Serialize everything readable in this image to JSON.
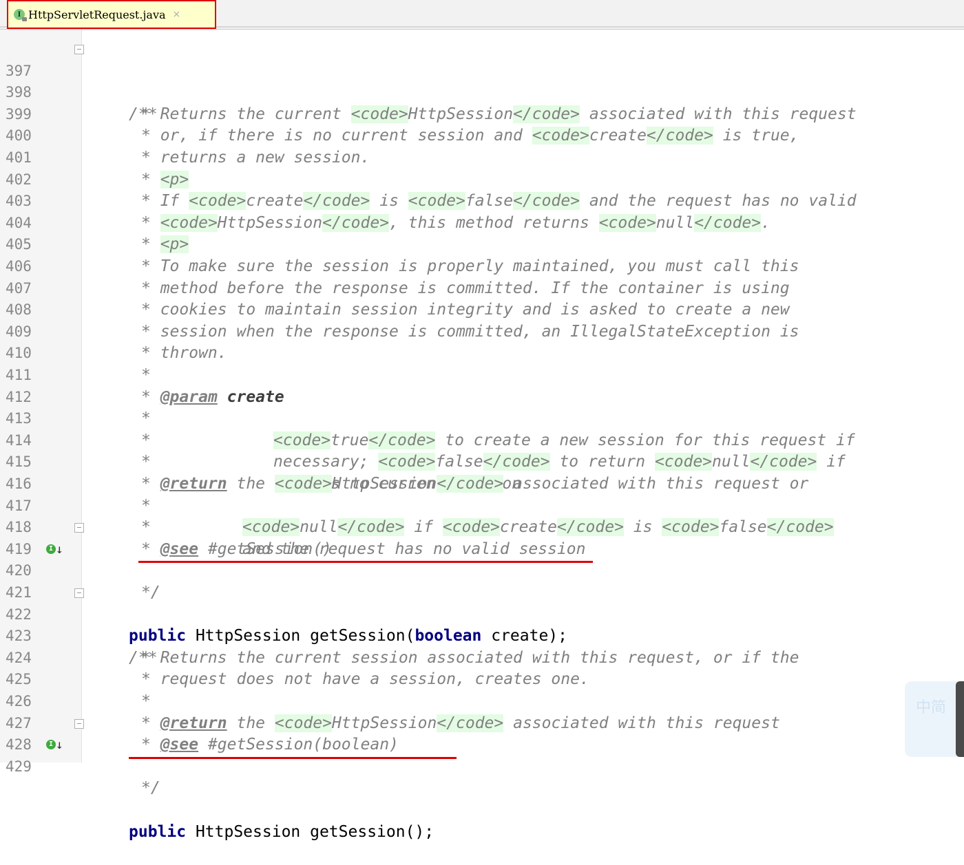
{
  "tab": {
    "icon_letter": "I",
    "filename": "HttpServletRequest.java",
    "close_glyph": "×"
  },
  "lines": [
    {
      "n": "397"
    },
    {
      "n": "398"
    },
    {
      "n": "399"
    },
    {
      "n": "400"
    },
    {
      "n": "401"
    },
    {
      "n": "402"
    },
    {
      "n": "403"
    },
    {
      "n": "404"
    },
    {
      "n": "405"
    },
    {
      "n": "406"
    },
    {
      "n": "407"
    },
    {
      "n": "408"
    },
    {
      "n": "409"
    },
    {
      "n": "410"
    },
    {
      "n": "411"
    },
    {
      "n": "412"
    },
    {
      "n": "413"
    },
    {
      "n": "414"
    },
    {
      "n": "415"
    },
    {
      "n": "416"
    },
    {
      "n": "417"
    },
    {
      "n": "418"
    },
    {
      "n": "419"
    },
    {
      "n": "420"
    },
    {
      "n": "421"
    },
    {
      "n": "422"
    },
    {
      "n": "423"
    },
    {
      "n": "424"
    },
    {
      "n": "425"
    },
    {
      "n": "426"
    },
    {
      "n": "427"
    },
    {
      "n": "428"
    },
    {
      "n": "429"
    }
  ],
  "code": {
    "l397": "/**",
    "l398a": "* Returns the current ",
    "l398t1": "<code>",
    "l398b": "HttpSession",
    "l398t2": "</code>",
    "l398c": " associated with this request",
    "l399a": "* or, if there is no current session and ",
    "l399t1": "<code>",
    "l399b": "create",
    "l399t2": "</code>",
    "l399c": " is true,",
    "l400": "* returns a new session.",
    "l401a": "* ",
    "l401t": "<p>",
    "l402a": "* If ",
    "l402t1": "<code>",
    "l402b": "create",
    "l402t2": "</code>",
    "l402c": " is ",
    "l402t3": "<code>",
    "l402d": "false",
    "l402t4": "</code>",
    "l402e": " and the request has no valid",
    "l403a": "* ",
    "l403t1": "<code>",
    "l403b": "HttpSession",
    "l403t2": "</code>",
    "l403c": ", this method returns ",
    "l403t3": "<code>",
    "l403d": "null",
    "l403t4": "</code>",
    "l403e": ".",
    "l404a": "* ",
    "l404t": "<p>",
    "l405": "* To make sure the session is properly maintained, you must call this",
    "l406": "* method before the response is committed. If the container is using",
    "l407": "* cookies to maintain session integrity and is asked to create a new",
    "l408": "* session when the response is committed, an IllegalStateException is",
    "l409": "* thrown.",
    "l410": "*",
    "l411a": "* ",
    "l411tag": "@param",
    "l411name": " create",
    "l412a": "*",
    "l412t1": "<code>",
    "l412b": "true",
    "l412t2": "</code>",
    "l412c": " to create a new session for this request if",
    "l413a": "*",
    "l413b": "necessary; ",
    "l413t1": "<code>",
    "l413c": "false",
    "l413t2": "</code>",
    "l413d": " to return ",
    "l413t3": "<code>",
    "l413e": "null",
    "l413t4": "</code>",
    "l413f": " if",
    "l414a": "*",
    "l414b": "there's no current session",
    "l415a": "* ",
    "l415tag": "@return",
    "l415b": " the ",
    "l415t1": "<code>",
    "l415c": "HttpSession",
    "l415t2": "</code>",
    "l415d": " associated with this request or",
    "l416a": "*",
    "l416t1": "<code>",
    "l416b": "null",
    "l416t2": "</code>",
    "l416c": " if ",
    "l416t3": "<code>",
    "l416d": "create",
    "l416t4": "</code>",
    "l416e": " is ",
    "l416t5": "<code>",
    "l416f": "false",
    "l416t6": "</code>",
    "l417a": "*",
    "l417b": "and the request has no valid session",
    "l418a": "* ",
    "l418tag": "@see",
    "l418b": " #getSession()",
    "l419": "*/",
    "l420kw": "public",
    "l420a": " HttpSession getSession(",
    "l420kw2": "boolean",
    "l420b": " create);",
    "l422": "/**",
    "l423": "* Returns the current session associated with this request, or if the",
    "l424": "* request does not have a session, creates one.",
    "l425": "*",
    "l426a": "* ",
    "l426tag": "@return",
    "l426b": " the ",
    "l426t1": "<code>",
    "l426c": "HttpSession",
    "l426t2": "</code>",
    "l426d": " associated with this request",
    "l427a": "* ",
    "l427tag": "@see",
    "l427b": " #getSession(boolean)",
    "l428": "*/",
    "l429kw": "public",
    "l429a": " HttpSession getSession();"
  },
  "gutter_icons": {
    "impl_letter": "I",
    "impl_arrow": "↓"
  },
  "widget": {
    "text": "中简"
  },
  "colors": {
    "keyword": "#000080",
    "comment": "#808080",
    "tag_bg": "#e3fce3",
    "highlight_red": "#e00000",
    "tab_bg": "#ffffcc"
  }
}
